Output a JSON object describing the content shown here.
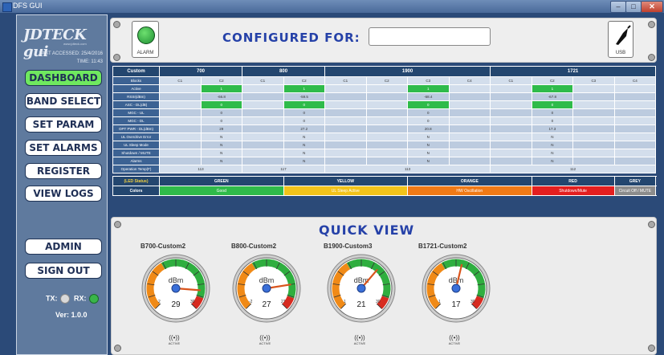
{
  "window": {
    "title": "DFS GUI",
    "min": "–",
    "max": "□",
    "close": "✕"
  },
  "sidebar": {
    "logo": "JDTECK gui",
    "logo_sub": "www.jdteck.com",
    "last_accessed_label": "LAST ACCESSED:",
    "last_accessed_date": "25/4/2016",
    "time_label": "TIME:",
    "time_value": "11:43",
    "nav": [
      "DASHBOARD",
      "BAND SELECT",
      "SET PARAM",
      "SET ALARMS",
      "REGISTER",
      "VIEW LOGS"
    ],
    "admin": "ADMIN",
    "signout": "SIGN OUT",
    "tx": "TX:",
    "rx": "RX:",
    "version": "Ver: 1.0.0",
    "colors": {
      "active": "#6fe85f",
      "tx_led": "#d9d9d9",
      "rx_led": "#39b54a"
    }
  },
  "top": {
    "alarm_label": "ALARM",
    "configured_for": "CONFIGURED FOR:",
    "configured_value": "",
    "usb_label": "USB"
  },
  "table": {
    "corner": "Custom",
    "bands": [
      "700",
      "800",
      "1900",
      "1721"
    ],
    "channels": [
      [
        "C1",
        "C2"
      ],
      [
        "C1",
        "C2"
      ],
      [
        "C1",
        "C2",
        "C3",
        "C4"
      ],
      [
        "C1",
        "C2",
        "C3",
        "C4"
      ]
    ],
    "rows": [
      {
        "label": "Active",
        "cells": [
          "",
          "1",
          "",
          "1",
          "",
          "",
          "1",
          "",
          "",
          "1",
          "",
          ""
        ]
      },
      {
        "label": "RSSI(dBm)",
        "cells": [
          "",
          "-66.8",
          "",
          "-59.5",
          "",
          "",
          "-68.4",
          "",
          "",
          "-67.8",
          "",
          ""
        ]
      },
      {
        "label": "ASC - DL(dB)",
        "cells": [
          "",
          "0",
          "",
          "0",
          "",
          "",
          "0",
          "",
          "",
          "0",
          "",
          ""
        ]
      },
      {
        "label": "MGC - UL",
        "cells": [
          "",
          "0",
          "",
          "0",
          "",
          "",
          "0",
          "",
          "",
          "0",
          "",
          ""
        ]
      },
      {
        "label": "MGC - DL",
        "cells": [
          "",
          "0",
          "",
          "0",
          "",
          "",
          "0",
          "",
          "",
          "0",
          "",
          ""
        ]
      },
      {
        "label": "OPT PWR - DL(dBm)",
        "cells": [
          "",
          "29",
          "",
          "27.2",
          "",
          "",
          "20.8",
          "",
          "",
          "17.3",
          "",
          ""
        ]
      },
      {
        "label": "UL Overdrive Error",
        "cells": [
          "",
          "N",
          "",
          "N",
          "",
          "",
          "N",
          "",
          "",
          "N",
          "",
          ""
        ]
      },
      {
        "label": "UL Sleep Mode",
        "cells": [
          "",
          "N",
          "",
          "N",
          "",
          "",
          "N",
          "",
          "",
          "N",
          "",
          ""
        ]
      },
      {
        "label": "Shutdown / MUTE",
        "cells": [
          "",
          "N",
          "",
          "N",
          "",
          "",
          "N",
          "",
          "",
          "N",
          "",
          ""
        ]
      },
      {
        "label": "Alarms",
        "cells": [
          "",
          "N",
          "",
          "N",
          "",
          "",
          "N",
          "",
          "",
          "N",
          "",
          ""
        ]
      }
    ],
    "temp_label": "Operation Temp(F)",
    "temps": [
      "113",
      "117",
      "113",
      "112"
    ],
    "green_rows": [
      0,
      2
    ],
    "led_label": "(LED Status)",
    "led_names": [
      "GREEN",
      "YELLOW",
      "ORANGE",
      "RED",
      "GREY"
    ],
    "colors_label": "Colors",
    "led_meanings": [
      "Good",
      "UL Sleep Active",
      "HW Oscillation",
      "Shutdown/Mute",
      "Circuit Off / MUTE"
    ],
    "led_colors": [
      "#2fbb4a",
      "#f2c31a",
      "#f07a16",
      "#e41f1f",
      "#8c8c8c"
    ]
  },
  "quickview": {
    "title": "QUICK VIEW",
    "gauges": [
      {
        "title": "B700-Custom2",
        "unit": "dBm",
        "value": 29,
        "min_label": "2",
        "max_label": "30"
      },
      {
        "title": "B800-Custom2",
        "unit": "dBm",
        "value": 27,
        "min_label": "-2",
        "max_label": "27"
      },
      {
        "title": "B1900-Custom3",
        "unit": "dBm",
        "value": 21,
        "min_label": "1",
        "max_label": "30"
      },
      {
        "title": "B1721-Custom2",
        "unit": "dBm",
        "value": 17,
        "min_label": "1",
        "max_label": "30"
      }
    ],
    "active_label": "ACTIVE"
  }
}
